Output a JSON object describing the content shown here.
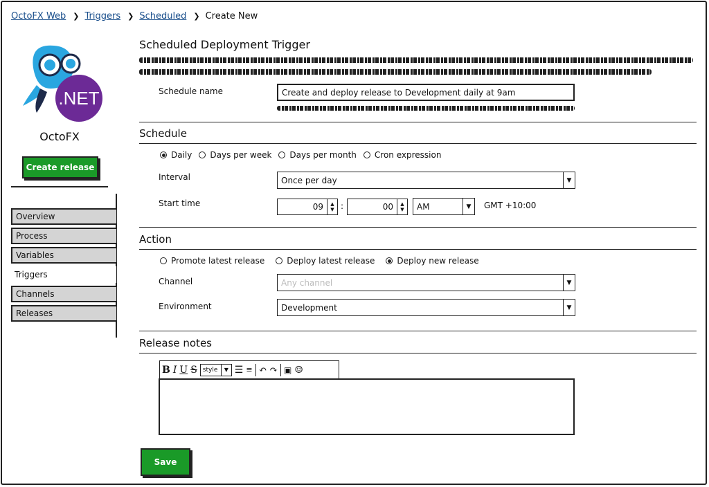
{
  "breadcrumb": {
    "items": [
      "OctoFX Web",
      "Triggers",
      "Scheduled"
    ],
    "current": "Create New"
  },
  "sidebar": {
    "project_name": "OctoFX",
    "logo_text": ".NET",
    "create_release_label": "Create release",
    "nav": [
      {
        "label": "Overview"
      },
      {
        "label": "Process"
      },
      {
        "label": "Variables"
      },
      {
        "label": "Triggers"
      },
      {
        "label": "Channels"
      },
      {
        "label": "Releases"
      }
    ],
    "active_nav": "Triggers"
  },
  "form": {
    "title": "Scheduled Deployment Trigger",
    "schedule_name": {
      "label": "Schedule name",
      "value": "Create and deploy release to Development daily at 9am"
    },
    "schedule": {
      "heading": "Schedule",
      "options": [
        "Daily",
        "Days per week",
        "Days per month",
        "Cron expression"
      ],
      "selected": "Daily",
      "interval_label": "Interval",
      "interval_value": "Once per day",
      "start_time_label": "Start time",
      "hour": "09",
      "time_sep": ":",
      "minute": "00",
      "ampm": "AM",
      "timezone": "GMT +10:00"
    },
    "action": {
      "heading": "Action",
      "options": [
        "Promote latest release",
        "Deploy latest release",
        "Deploy new release"
      ],
      "selected": "Deploy new release",
      "channel_label": "Channel",
      "channel_placeholder": "Any channel",
      "environment_label": "Environment",
      "environment_value": "Development"
    },
    "release_notes": {
      "heading": "Release notes",
      "toolbar": {
        "bold": "B",
        "italic": "I",
        "underline": "U",
        "strike": "S",
        "style": "style"
      }
    },
    "save_label": "Save"
  },
  "colors": {
    "accent_green": "#1a9a28",
    "link_blue": "#1a4f8c",
    "nav_grey": "#d4d4d4",
    "dotnet_purple": "#6c2a96",
    "logo_blue": "#2aa6e0"
  }
}
